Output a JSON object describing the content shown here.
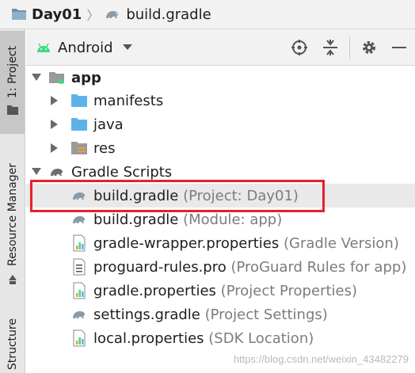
{
  "breadcrumb": {
    "project": "Day01",
    "file": "build.gradle"
  },
  "stripe": {
    "project_tab": "1: Project",
    "resource_manager_tab": "Resource Manager",
    "structure_tab": "Structure"
  },
  "toolbar": {
    "view_mode": "Android",
    "icons": [
      "locate-icon",
      "collapse-all-icon",
      "gear-icon",
      "hide-icon"
    ]
  },
  "tree": {
    "app": {
      "label": "app"
    },
    "manifests": {
      "label": "manifests"
    },
    "java": {
      "label": "java"
    },
    "res": {
      "label": "res"
    },
    "gradle_scripts": {
      "label": "Gradle Scripts"
    },
    "files": [
      {
        "name": "build.gradle",
        "hint": "(Project: Day01)",
        "icon": "gradle-icon"
      },
      {
        "name": "build.gradle",
        "hint": "(Module: app)",
        "icon": "gradle-icon"
      },
      {
        "name": "gradle-wrapper.properties",
        "hint": "(Gradle Version)",
        "icon": "properties-file-icon"
      },
      {
        "name": "proguard-rules.pro",
        "hint": "(ProGuard Rules for app)",
        "icon": "text-file-icon"
      },
      {
        "name": "gradle.properties",
        "hint": "(Project Properties)",
        "icon": "properties-file-icon"
      },
      {
        "name": "settings.gradle",
        "hint": "(Project Settings)",
        "icon": "gradle-icon"
      },
      {
        "name": "local.properties",
        "hint": "(SDK Location)",
        "icon": "properties-file-icon"
      }
    ]
  },
  "watermark": "https://blog.csdn.net/weixin_43482279",
  "colors": {
    "highlight_border": "#e8202a",
    "android_green": "#3ddc84",
    "folder_blue": "#5db3e8"
  }
}
